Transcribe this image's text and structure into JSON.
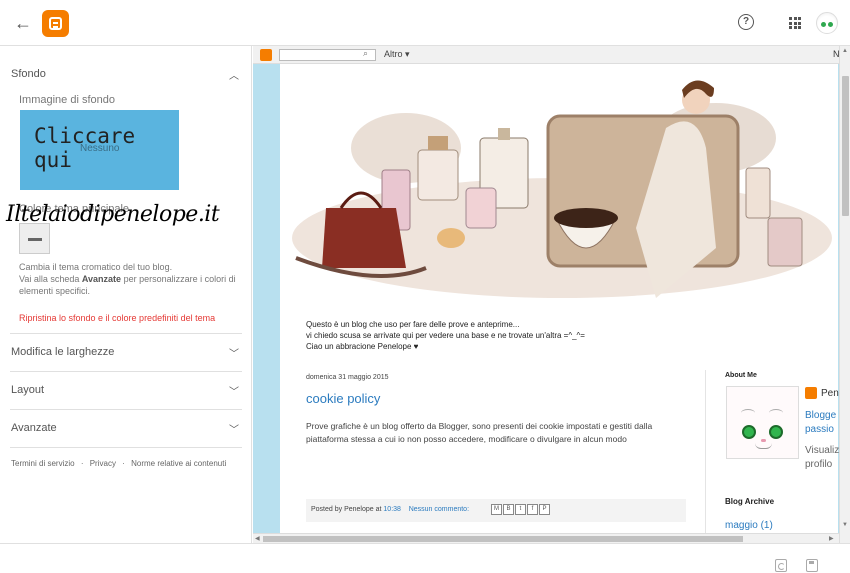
{
  "topbar": {
    "back_icon": "arrow-left-icon",
    "logo_icon": "blogger-logo-icon",
    "help_icon": "help-circle-icon",
    "apps_icon": "apps-grid-icon",
    "avatar_icon": "user-avatar-icon",
    "brand_color": "#f57d00"
  },
  "sidebar": {
    "sfondo": {
      "title": "Sfondo",
      "bg_image_label": "Immagine di sfondo",
      "bg_image_cta": "Cliccare qui",
      "bg_image_value": "Nessuno",
      "watermark": "Iltelaiodipenelope.it",
      "main_color_label": "Colore tema principale",
      "description_part1": "Cambia il tema cromatico del tuo blog.",
      "description_part2a": "Vai alla scheda ",
      "description_bold": "Avanzate",
      "description_part2b": " per personalizzare i colori di elementi specifici.",
      "reset_link": "Ripristina lo sfondo e il colore predefiniti del tema",
      "reset_color": "#e53935",
      "preview_color": "#5ab4df"
    },
    "sections": [
      {
        "title": "Modifica le larghezze"
      },
      {
        "title": "Layout"
      },
      {
        "title": "Avanzate"
      }
    ],
    "footer": {
      "terms": "Termini di servizio",
      "privacy": "Privacy",
      "content_policy": "Norme relative ai contenuti",
      "separator": "·"
    }
  },
  "preview": {
    "navbar": {
      "search_placeholder": "",
      "more": "Altro ▾",
      "right_text": "N"
    },
    "intro_lines": [
      "Questo è un blog che uso per fare delle prove e anteprime...",
      "vi chiedo scusa se arrivate qui per vedere una base e ne trovate un'altra =^_^=",
      "Ciao un abbracione Penelope ♥"
    ],
    "post": {
      "date": "domenica 31 maggio 2015",
      "title": "cookie policy",
      "body": "Prove grafiche è un blog offerto da Blogger, sono presenti dei cookie impostati e gestiti dalla piattaforma stessa a cui io non posso accedere, modificare o divulgare in alcun modo",
      "footer_posted_by": "Posted by ",
      "footer_author": "Penelope",
      "footer_at": " at ",
      "footer_time": "10:38",
      "footer_comments": "Nessun commento:",
      "link_color": "#2b7bbf"
    },
    "about": {
      "title": "About Me",
      "profile_name": "Pene",
      "profile_link_1": "Blogge",
      "profile_link_2": "passio",
      "view_1": "Visualiz",
      "view_2": "profilo"
    },
    "archive": {
      "title": "Blog Archive",
      "link": "maggio (1)"
    },
    "background_color": "#b8e0ef"
  },
  "bottombar": {
    "revert_icon": "revert-icon",
    "save_icon": "save-icon"
  }
}
